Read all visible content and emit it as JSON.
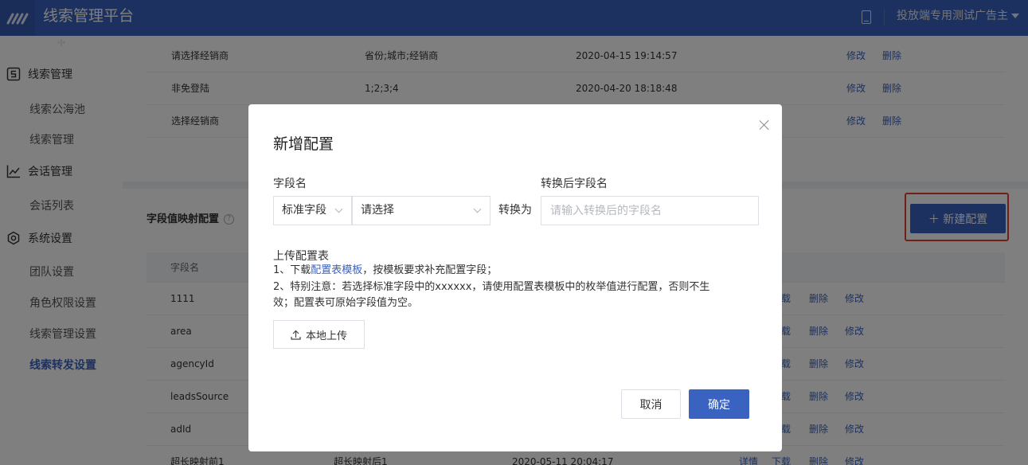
{
  "header": {
    "app_title": "线索管理平台",
    "account": "投放端专用测试广告主",
    "logo_icon": "logo-slash-icon",
    "bg_color": "#3a62c0"
  },
  "sidebar": {
    "collapse_glyph": "›|‹",
    "groups": [
      {
        "label": "线索管理",
        "icon": "leads-icon",
        "items": [
          "线索公海池",
          "线索管理"
        ]
      },
      {
        "label": "会话管理",
        "icon": "chart-line-icon",
        "items": [
          "会话列表"
        ]
      },
      {
        "label": "系统设置",
        "icon": "gear-icon",
        "items": [
          "团队设置",
          "角色权限设置",
          "线索管理设置",
          "线索转发设置"
        ]
      }
    ],
    "active_item": "线索转发设置"
  },
  "top_table": {
    "rows": [
      {
        "name": "请选择经销商",
        "fields": "省份;城市;经销商",
        "time": "2020-04-15 19:14:57",
        "edit": "修改",
        "delete": "删除"
      },
      {
        "name": "非免登陆",
        "fields": "1;2;3;4",
        "time": "2020-04-20 18:18:48",
        "edit": "修改",
        "delete": "删除"
      },
      {
        "name": "选择经销商",
        "fields": "",
        "time": "",
        "edit": "修改",
        "delete": "删除"
      }
    ]
  },
  "mapping": {
    "section_title": "字段值映射配置",
    "help_icon": "?",
    "new_button": "＋ 新建配置",
    "column_header": "字段名",
    "rows": [
      {
        "name": "1111",
        "mapped": "",
        "time": "",
        "detail": "",
        "download": "下载",
        "delete": "删除",
        "edit": "修改"
      },
      {
        "name": "area",
        "mapped": "",
        "time": "",
        "detail": "",
        "download": "下载",
        "delete": "删除",
        "edit": "修改"
      },
      {
        "name": "agencyId",
        "mapped": "",
        "time": "",
        "detail": "",
        "download": "下载",
        "delete": "删除",
        "edit": "修改"
      },
      {
        "name": "leadsSource",
        "mapped": "",
        "time": "",
        "detail": "",
        "download": "下载",
        "delete": "删除",
        "edit": "修改"
      },
      {
        "name": "adId",
        "mapped": "",
        "time": "",
        "detail": "",
        "download": "下载",
        "delete": "删除",
        "edit": "修改"
      },
      {
        "name": "超长映射前1",
        "mapped": "超长映射后1",
        "time": "2020-05-11 20:04:17",
        "detail": "详情",
        "download": "下载",
        "delete": "删除",
        "edit": "修改"
      }
    ]
  },
  "modal": {
    "title": "新增配置",
    "field_label": "字段名",
    "target_label": "转换后字段名",
    "type_select": "标准字段",
    "field_select": "请选择",
    "convert_text": "转换为",
    "target_placeholder": "请输入转换后的字段名",
    "upload_title": "上传配置表",
    "note1_prefix": "1、下载",
    "note1_link": "配置表模板",
    "note1_suffix": "，按模板要求补充配置字段；",
    "note2_line1": "2、特别注意：若选择标准字段中的xxxxxx，请使用配置表模板中的枚举值进行配置，否则不生",
    "note2_line2": "效；配置表可原始字段值为空。",
    "upload_button": "本地上传",
    "cancel_button": "取消",
    "ok_button": "确定"
  }
}
